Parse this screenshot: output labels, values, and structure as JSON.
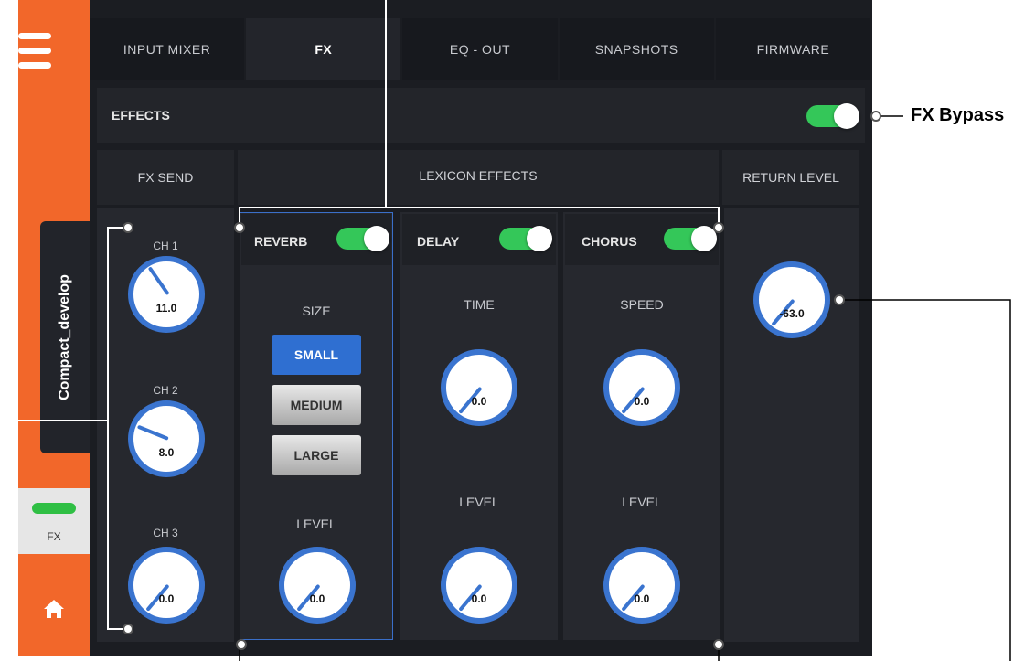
{
  "sidebar": {
    "device_name": "Compact_develop",
    "fx_label": "FX",
    "colors": {
      "sidebar": "#f2672a",
      "led": "#2fbf44"
    },
    "icons": [
      "menu-icon",
      "home-icon"
    ]
  },
  "tabs": [
    "INPUT MIXER",
    "FX",
    "EQ - OUT",
    "SNAPSHOTS",
    "FIRMWARE"
  ],
  "active_tab": "FX",
  "effects": {
    "title": "EFFECTS",
    "bypass_on": true
  },
  "fx_send": {
    "title": "FX SEND",
    "channels": [
      {
        "label": "CH 1",
        "value": "11.0"
      },
      {
        "label": "CH 2",
        "value": "8.0"
      },
      {
        "label": "CH 3",
        "value": "0.0"
      }
    ]
  },
  "lexicon": {
    "title": "LEXICON EFFECTS",
    "reverb": {
      "label": "REVERB",
      "enabled": true,
      "size_label": "SIZE",
      "sizes": [
        "SMALL",
        "MEDIUM",
        "LARGE"
      ],
      "selected_size": "SMALL",
      "level_label": "LEVEL",
      "level_value": "0.0"
    },
    "delay": {
      "label": "DELAY",
      "enabled": true,
      "time_label": "TIME",
      "time_value": "0.0",
      "level_label": "LEVEL",
      "level_value": "0.0"
    },
    "chorus": {
      "label": "CHORUS",
      "enabled": true,
      "speed_label": "SPEED",
      "speed_value": "0.0",
      "level_label": "LEVEL",
      "level_value": "0.0"
    }
  },
  "return_level": {
    "title": "RETURN LEVEL",
    "value": "-63.0"
  },
  "callouts": {
    "fx_bypass": "FX Bypass"
  },
  "colors": {
    "accent": "#3a74cf",
    "toggle_on": "#34c759",
    "panel": "#1b1d22"
  }
}
